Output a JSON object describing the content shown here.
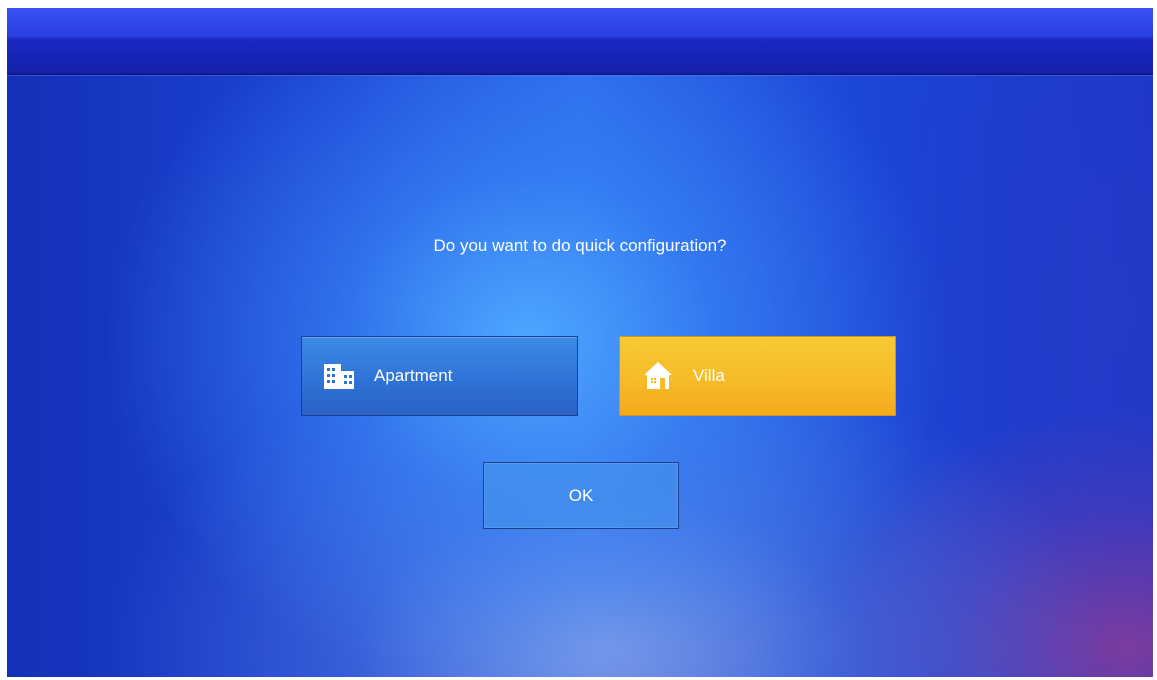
{
  "dialog": {
    "question": "Do you want to do quick configuration?",
    "options": {
      "apartment": {
        "label": "Apartment",
        "icon": "building-icon",
        "selected": false
      },
      "villa": {
        "label": "Villa",
        "icon": "house-icon",
        "selected": true
      }
    },
    "ok_label": "OK"
  },
  "colors": {
    "selected_accent": "#f6bb28",
    "unselected_option": "#2f73d6",
    "background": "#1c46d6"
  }
}
